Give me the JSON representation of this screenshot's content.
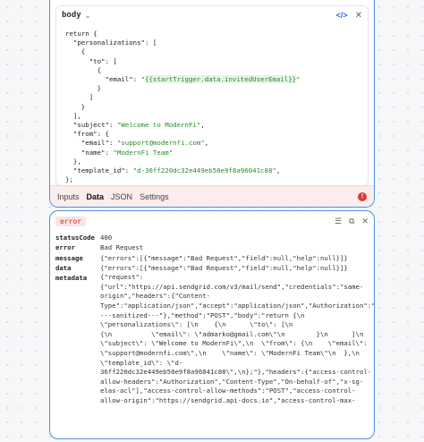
{
  "editor": {
    "title": "body",
    "code_lines": [
      "return {",
      "  \"personalizations\": [",
      "    {",
      "      \"to\": [",
      "        {",
      "          \"email\": \"{{startTrigger.data.invitedUserEmail}}\"",
      "        }",
      "      ]",
      "    }",
      "  ],",
      "  \"subject\": \"Welcome to ModernFi\",",
      "  \"from\": {",
      "    \"email\": \"support@modernfi.com\",",
      "    \"name\": \"ModernFi Team\"",
      "  },",
      "  \"template_id\": \"d-36ff220dc32e449eb50e9f8a96041c88\",",
      "};"
    ],
    "template_expr": "{{startTrigger.data.invitedUserEmail}}"
  },
  "tabs": [
    "Inputs",
    "Data",
    "JSON",
    "Settings"
  ],
  "active_tab": "Data",
  "error_icon": "!",
  "result": {
    "badge": "error",
    "rows": [
      {
        "key": "statusCode",
        "value": "400"
      },
      {
        "key": "error",
        "value": "Bad Request"
      },
      {
        "key": "message",
        "value": "{\"errors\":[{\"message\":\"Bad Request\",\"field\":null,\"help\":null}]}"
      },
      {
        "key": "data",
        "value": "{\"errors\":[{\"message\":\"Bad Request\",\"field\":null,\"help\":null}]}"
      }
    ],
    "metadata_key": "metadata",
    "metadata_lines": [
      "{\"request\":",
      "{\"url\":\"https://api.sendgrid.com/v3/mail/send\",\"credentials\":\"same-",
      "origin\",\"headers\":{\"Content-",
      "Type\":\"application/json\",\"accept\":\"application/json\",\"Authorization\":\"",
      "---sanitized---\"},\"method\":\"POST\",\"body\":\"return {\\n",
      "\\\"personalizations\\\": [\\n    {\\n      \\\"to\\\": [\\n",
      "{\\n          \\\"email\\\": \\\"admarko@gmail.com\\\"\\n        }\\n      ]\\n    }\\n  ],\\n",
      "\\\"subject\\\": \\\"Welcome to ModernFi\\\",\\n  \\\"from\\\": {\\n    \\\"email\\\":",
      "\\\"support@modernfi.com\\\",\\n    \\\"name\\\": \\\"ModernFi Team\\\"\\n  },\\n",
      "\\\"template_id\\\": \\\"d-",
      "36ff220dc32e449eb50e9f8a96041c88\\\",\\n};\"},\"headers\":{\"access-control-",
      "allow-headers\":\"Authorization\",\"Content-Type\",\"On-behalf-of\",\"x-sg-",
      "elas-acl\"],\"access-control-allow-methods\":\"POST\",\"access-control-",
      "allow-origin\":\"https://sendgrid.api-docs.io\",\"access-control-max-"
    ]
  }
}
